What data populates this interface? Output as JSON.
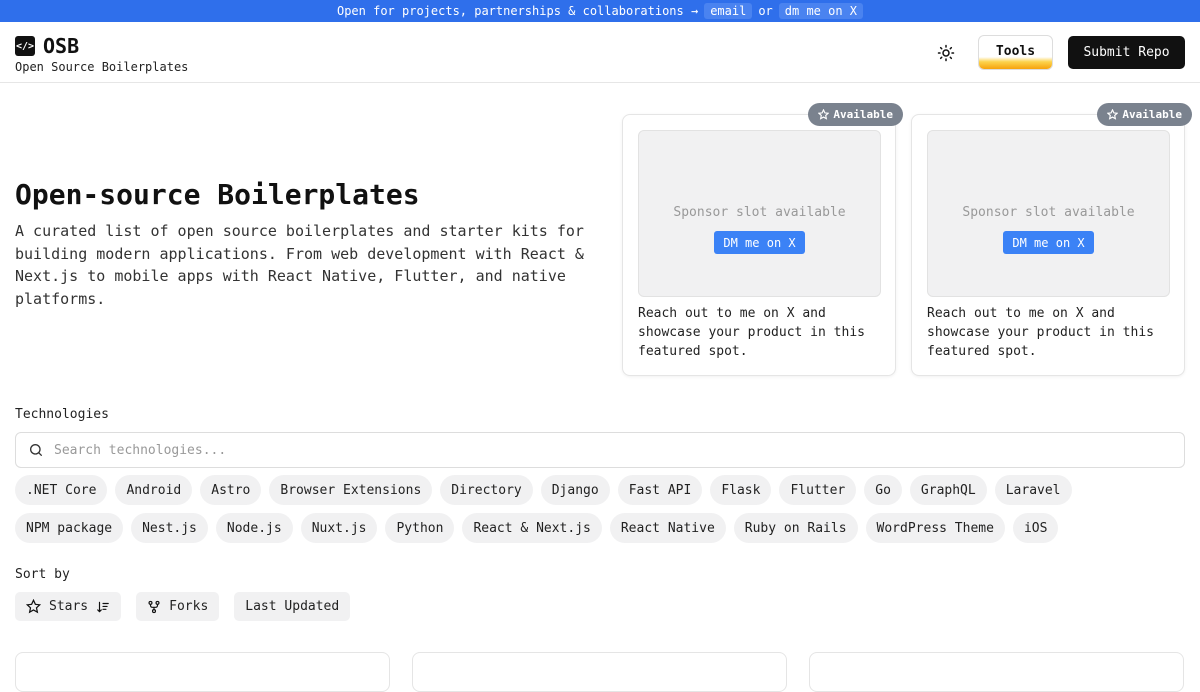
{
  "banner": {
    "text": "Open for projects, partnerships & collaborations →",
    "email_label": "email",
    "or_label": "or",
    "dm_label": "dm me on X"
  },
  "header": {
    "logo_icon_text": "</>",
    "logo_text": "OSB",
    "subtitle": "Open Source Boilerplates",
    "tools_label": "Tools",
    "submit_label": "Submit Repo"
  },
  "hero": {
    "title": "Open-source Boilerplates",
    "description": "A curated list of open source boilerplates and starter kits for building modern applications. From web development with React & Next.js to mobile apps with React Native, Flutter, and native platforms."
  },
  "sponsors": [
    {
      "badge": "Available",
      "slot_text": "Sponsor slot available",
      "button": "DM me on X",
      "description": "Reach out to me on X and showcase your product in this featured spot."
    },
    {
      "badge": "Available",
      "slot_text": "Sponsor slot available",
      "button": "DM me on X",
      "description": "Reach out to me on X and showcase your product in this featured spot."
    }
  ],
  "technologies": {
    "label": "Technologies",
    "search_placeholder": "Search technologies...",
    "row1": [
      ".NET Core",
      "Android",
      "Astro",
      "Browser Extensions",
      "Directory",
      "Django",
      "Fast API",
      "Flask",
      "Flutter",
      "Go",
      "GraphQL",
      "Laravel"
    ],
    "row2": [
      "NPM package",
      "Nest.js",
      "Node.js",
      "Nuxt.js",
      "Python",
      "React & Next.js",
      "React Native",
      "Ruby on Rails",
      "WordPress Theme",
      "iOS"
    ]
  },
  "sort": {
    "label": "Sort by",
    "stars": "Stars",
    "forks": "Forks",
    "updated": "Last Updated"
  },
  "icons": {
    "search": "search-icon",
    "sun": "sun-icon",
    "star": "star-icon",
    "fork": "fork-icon",
    "sort_desc": "sort-descending-icon"
  },
  "colors": {
    "banner": "#2f6feb",
    "accent": "#3b82f6",
    "badge": "#7a828e",
    "submit": "#111111"
  }
}
